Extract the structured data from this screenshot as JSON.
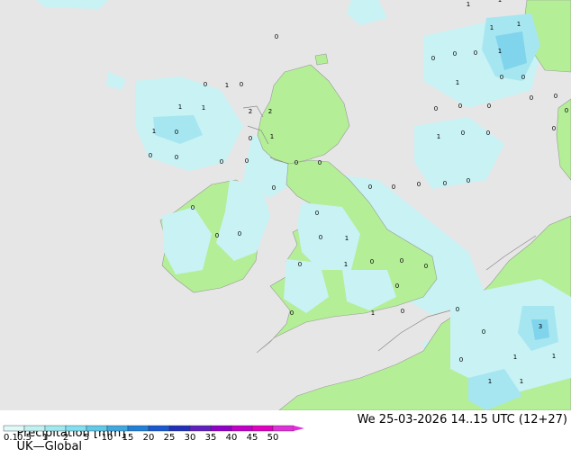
{
  "footer": {
    "title": "Precipitation [mm]",
    "model": "UK—Global",
    "valid_time": "We 25-03-2026 14..15 UTC (12+27)"
  },
  "legend": {
    "labels": [
      "0.1",
      "0.5",
      "1",
      "2",
      "5",
      "10",
      "15",
      "20",
      "25",
      "30",
      "35",
      "40",
      "45",
      "50"
    ],
    "colors": [
      "#e0f8f8",
      "#c0f0f0",
      "#a0e8f0",
      "#80e0f0",
      "#60c8e8",
      "#40a8e0",
      "#2080d8",
      "#1858d0",
      "#2030b8",
      "#6020c0",
      "#9000c8",
      "#c000c8",
      "#e000c0",
      "#e030d8"
    ]
  },
  "colors": {
    "sea": "#e6e6e6",
    "land": "#b4ee96",
    "light_precip": "#c8f2f4",
    "medium_precip": "#a6e6f0",
    "heavy_precip": "#80d4ec",
    "coast": "#9a9a9a"
  },
  "point_values": [
    "0",
    "1",
    "0",
    "0",
    "1",
    "1",
    "2",
    "2",
    "1",
    "1",
    "1",
    "1",
    "1",
    "1",
    "0",
    "0",
    "0",
    "0",
    "0",
    "0",
    "1",
    "0",
    "0",
    "0",
    "0",
    "1",
    "0",
    "0",
    "0",
    "0",
    "0",
    "1",
    "0",
    "0",
    "0",
    "0",
    "0",
    "0",
    "0",
    "0",
    "0",
    "0",
    "0",
    "0",
    "0",
    "0",
    "1",
    "1",
    "0",
    "0",
    "0",
    "0",
    "0",
    "0",
    "0",
    "0",
    "0",
    "0",
    "1",
    "0",
    "0",
    "0",
    "3",
    "1",
    "1",
    "1",
    "0",
    "1"
  ]
}
